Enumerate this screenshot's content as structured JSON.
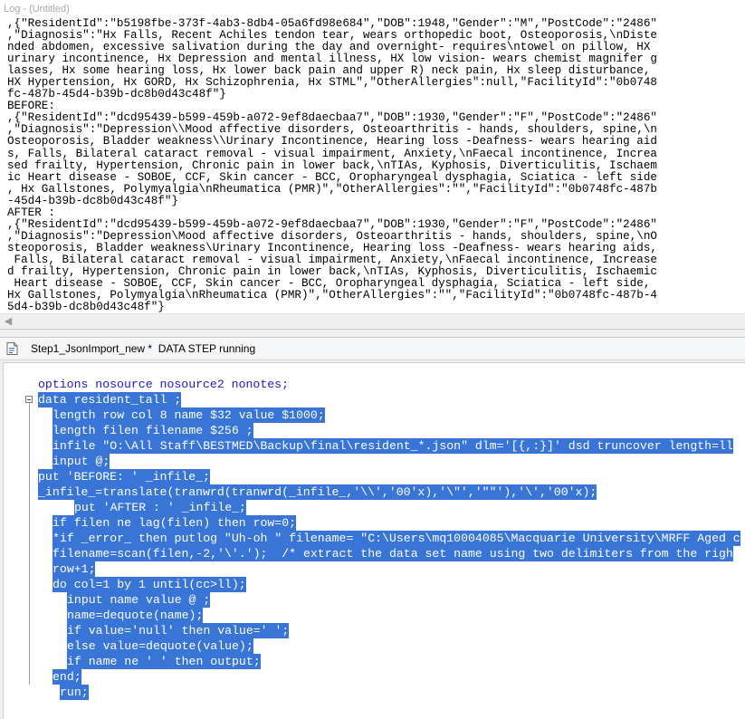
{
  "log": {
    "title": "Log - (Untitled)",
    "lines": [
      ",{\"ResidentId\":\"b5198fbe-373f-4ab3-8db4-05a6fd98e684\",\"DOB\":1948,\"Gender\":\"M\",\"PostCode\":\"2486\"",
      ",\"Diagnosis\":\"Hx Falls, Recent Achiles tendon tear, wears orthopedic boot, Osteoporosis,\\nDiste",
      "nded abdomen, excessive salivation during the day and overnight- requires\\ntowel on pillow, HX",
      "urinary incontinence, Hx Depression and mental illness, HX low vision- wears chemist magnifer g",
      "lasses, Hx some hearing loss, Hx lower back pain and upper R) neck pain, Hx sleep disturbance,",
      "HX Hypertension, Hx GORD, Hx Schizophrenia, Hx STML\",\"OtherAllergies\":null,\"FacilityId\":\"0b0748",
      "fc-487b-45d4-b39b-dc8b0d43c48f\"}",
      "BEFORE:",
      ",{\"ResidentId\":\"dcd95439-b599-459b-a072-9ef8daecbaa7\",\"DOB\":1930,\"Gender\":\"F\",\"PostCode\":\"2486\"",
      ",\"Diagnosis\":\"Depression\\\\Mood affective disorders, Osteoarthritis - hands, shoulders, spine,\\n",
      "Osteoporosis, Bladder weakness\\\\Urinary Incontinence, Hearing loss -Deafness- wears hearing aid",
      "s, Falls, Bilateral cataract removal - visual impairment, Anxiety,\\nFaecal incontinence, Increa",
      "sed frailty, Hypertension, Chronic pain in lower back,\\nTIAs, Kyphosis, Diverticulitis, Ischaem",
      "ic Heart disease - SOBOE, CCF, Skin cancer - BCC, Oropharyngeal dysphagia, Sciatica - left side",
      ", Hx Gallstones, Polymyalgia\\nRheumatica (PMR)\",\"OtherAllergies\":\"\",\"FacilityId\":\"0b0748fc-487b",
      "-45d4-b39b-dc8b0d43c48f\"}",
      "AFTER :",
      ",{\"ResidentId\":\"dcd95439-b599-459b-a072-9ef8daecbaa7\",\"DOB\":1930,\"Gender\":\"F\",\"PostCode\":\"2486\"",
      ",\"Diagnosis\":\"Depression\\Mood affective disorders, Osteoarthritis - hands, shoulders, spine,\\nO",
      "steoporosis, Bladder weakness\\Urinary Incontinence, Hearing loss -Deafness- wears hearing aids,",
      " Falls, Bilateral cataract removal - visual impairment, Anxiety,\\nFaecal incontinence, Increase",
      "d frailty, Hypertension, Chronic pain in lower back,\\nTIAs, Kyphosis, Diverticulitis, Ischaemic",
      " Heart disease - SOBOE, CCF, Skin cancer - BCC, Oropharyngeal dysphagia, Sciatica - left side,",
      "Hx Gallstones, Polymyalgia\\nRheumatica (PMR)\",\"OtherAllergies\":\"\",\"FacilityId\":\"0b0748fc-487b-4",
      "5d4-b39b-dc8b0d43c48f\"}"
    ],
    "scroll_left_icon": "scroll-left-arrow-icon"
  },
  "editor": {
    "title": "Step1_JsonImport_new *  DATA STEP running",
    "doc_icon": "program-document-icon",
    "colors": {
      "selection": "#3875d7",
      "code": "#1a1ad0"
    },
    "lines": [
      {
        "indent": 38,
        "selected": false,
        "text": "options nosource nosource2 nonotes;"
      },
      {
        "indent": 38,
        "selected": true,
        "fold": true,
        "text": "data resident_tall ;"
      },
      {
        "indent": 54,
        "selected": true,
        "text": "length row col 8 name $32 value $1000;"
      },
      {
        "indent": 54,
        "selected": true,
        "text": "length filen filename $256 ;"
      },
      {
        "indent": 54,
        "selected": true,
        "text": "infile \"O:\\All Staff\\BESTMED\\Backup\\final\\resident_*.json\" dlm='[{,:}]' dsd truncover length=ll"
      },
      {
        "indent": 54,
        "selected": true,
        "text": "input @;"
      },
      {
        "indent": 38,
        "selected": true,
        "text": "put 'BEFORE: ' _infile_;"
      },
      {
        "indent": 38,
        "selected": true,
        "text": "_infile_=translate(tranwrd(tranwrd(_infile_,'\\\\','00'x),'\\\"','\"\"'),'\\','00'x);"
      },
      {
        "indent": 78,
        "selected": true,
        "text": "put 'AFTER : ' _infile_;"
      },
      {
        "indent": 54,
        "selected": true,
        "text": "if filen ne lag(filen) then row=0;"
      },
      {
        "indent": 54,
        "selected": true,
        "text": "*if _error_ then putlog \"Uh-oh \" filename= \"C:\\Users\\mq10004085\\Macquarie University\\MRFF Aged c"
      },
      {
        "indent": 54,
        "selected": true,
        "text": "filename=scan(filen,-2,'\\'.');  /* extract the data set name using two delimiters from the righ"
      },
      {
        "indent": 54,
        "selected": true,
        "text": "row+1;"
      },
      {
        "indent": 54,
        "selected": true,
        "text": "do col=1 by 1 until(cc>ll);"
      },
      {
        "indent": 70,
        "selected": true,
        "text": "input name value @ ;"
      },
      {
        "indent": 70,
        "selected": true,
        "text": "name=dequote(name);"
      },
      {
        "indent": 70,
        "selected": true,
        "text": "if value='null' then value=' ';"
      },
      {
        "indent": 70,
        "selected": true,
        "text": "else value=dequote(value);"
      },
      {
        "indent": 70,
        "selected": true,
        "text": "if name ne ' ' then output;"
      },
      {
        "indent": 54,
        "selected": true,
        "text": "end;"
      },
      {
        "indent": 62,
        "selected": true,
        "text": "run;"
      }
    ]
  }
}
